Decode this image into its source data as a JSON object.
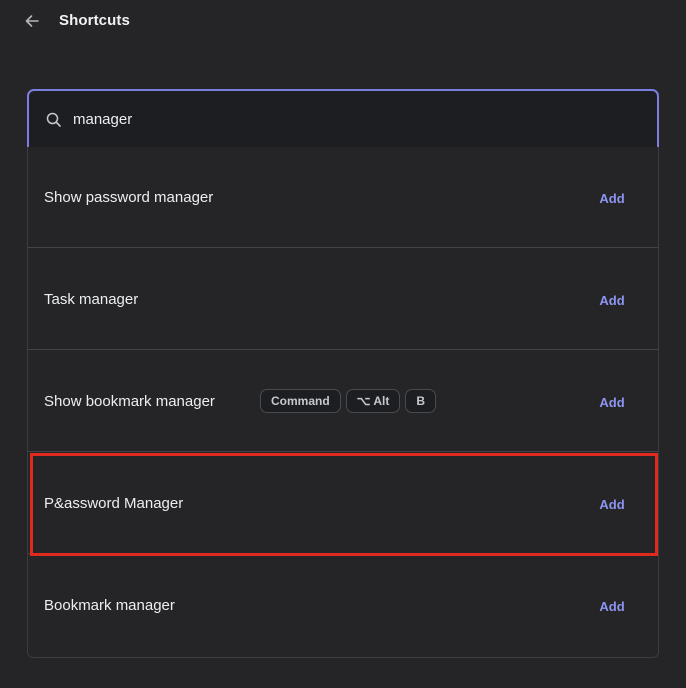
{
  "header": {
    "title": "Shortcuts",
    "back_icon": "arrow-left-icon"
  },
  "search": {
    "value": "manager",
    "icon": "search-icon"
  },
  "shortcuts": [
    {
      "label": "Show password manager",
      "action": "Add",
      "keys": []
    },
    {
      "label": "Task manager",
      "action": "Add",
      "keys": []
    },
    {
      "label": "Show bookmark manager",
      "action": "Add",
      "keys": [
        "Command",
        "⌥ Alt",
        "B"
      ]
    },
    {
      "label": "P&assword Manager",
      "action": "Add",
      "keys": []
    },
    {
      "label": "Bookmark manager",
      "action": "Add",
      "keys": []
    }
  ],
  "colors": {
    "background": "#252528",
    "accent": "#8d95f0",
    "search_border": "#7b7ee0",
    "highlight": "#e02a20"
  }
}
